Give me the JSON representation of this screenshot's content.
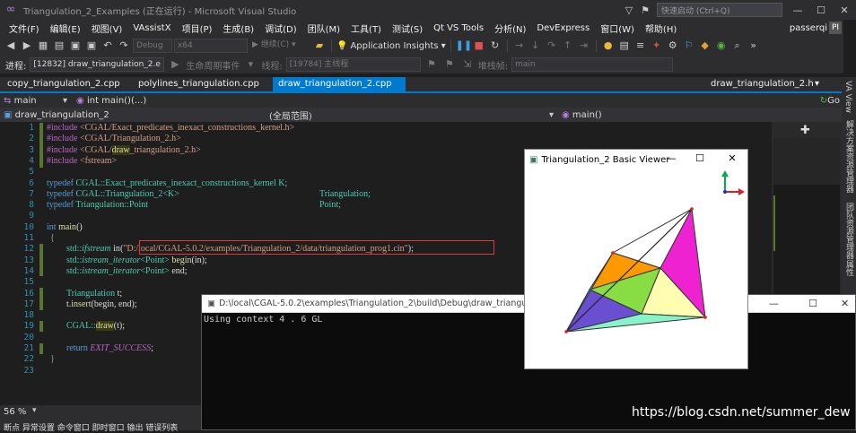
{
  "window": {
    "title": "Triangulation_2_Examples (正在运行) - Microsoft Visual Studio",
    "quick_launch_placeholder": "快速启动 (Ctrl+Q)"
  },
  "menu": [
    "文件(F)",
    "编辑(E)",
    "视图(V)",
    "VAssistX",
    "项目(P)",
    "生成(B)",
    "调试(D)",
    "团队(M)",
    "工具(T)",
    "测试(S)",
    "Qt VS Tools",
    "分析(N)",
    "DevExpress",
    "窗口(W)",
    "帮助(H)"
  ],
  "user": {
    "name": "passerqi",
    "avatar": "PI"
  },
  "toolbar": {
    "config": "Debug",
    "platform": "x64",
    "continue": "▶ 继续(C) ▾",
    "app_insights": "Application Insights"
  },
  "process_bar": {
    "process_label": "进程:",
    "process_value": "[12832] draw_triangulation_2.e",
    "lifecycle_label": "生命周期事件",
    "thread_label": "线程:",
    "thread_value": "[19784] 主线程",
    "stack_label": "堆栈帧:",
    "stack_value": "main"
  },
  "tabs": [
    "copy_triangulation_2.cpp",
    "polylines_triangulation.cpp",
    "draw_triangulation_2.cpp",
    "draw_triangulation_2.h"
  ],
  "nav": {
    "scope": "main",
    "func": "int main()(...)",
    "go": "Go"
  },
  "scope": {
    "project": "draw_triangulation_2",
    "range": "(全局范围)",
    "member": "main()"
  },
  "code_lines": [
    "1",
    "2",
    "3",
    "4",
    "5",
    "6",
    "7",
    "8",
    "9",
    "10",
    "11",
    "12",
    "13",
    "14",
    "15",
    "16",
    "17",
    "18",
    "19",
    "20",
    "21",
    "22",
    "23"
  ],
  "code": {
    "inc1a": "#include ",
    "inc1b": "<CGAL/Exact_predicates_inexact_constructions_kernel.h>",
    "inc2a": "#include ",
    "inc2b": "<CGAL/Triangulation_2.h>",
    "inc3a": "#include ",
    "inc3b": "<CGAL/",
    "inc3c": "draw",
    "inc3d": "_triangulation_2.h>",
    "inc4a": "#include ",
    "inc4b": "<fstream>",
    "td1a": "typedef ",
    "td1b": "CGAL::Exact_predicates_inexact_constructions_kernel ",
    "td1c": "K;",
    "td2a": "typedef ",
    "td2b": "CGAL::Triangulation_2<K>",
    "td2c": "Triangulation;",
    "td3a": "typedef ",
    "td3b": "Triangulation::Point",
    "td3c": "Point;",
    "main_a": "int ",
    "main_b": "main",
    "main_c": "()",
    "brace_open": "{",
    "l12a": "std::",
    "l12b": "ifstream ",
    "l12c": "in",
    "l12d": "(",
    "l12e": "\"D:/local/CGAL-5.0.2/examples/Triangulation_2/data/triangulation_prog1.cin\"",
    "l12f": ");",
    "l13a": "std::",
    "l13b": "istream_iterator",
    "l13c": "<Point> ",
    "l13d": "begin",
    "l13e": "(in);",
    "l14a": "std::",
    "l14b": "istream_iterator",
    "l14c": "<Point> ",
    "l14d": "end;",
    "l16a": "Triangulation ",
    "l16b": "t;",
    "l17a": "t.",
    "l17b": "insert",
    "l17c": "(begin, end);",
    "l19a": "CGAL::",
    "l19b": "draw",
    "l19c": "(t);",
    "l21a": "return ",
    "l21b": "EXIT_SUCCESS",
    ";": ";",
    "brace_close": "}"
  },
  "right_panel": {
    "va_view": "VA View",
    "solution": "解决方案资源管理器",
    "team": "团队资源管理器",
    "properties": "属性"
  },
  "status": {
    "zoom": "56 %",
    "bottom_tabs": "断点  异常设置  命令窗口  即时窗口  输出  错误列表"
  },
  "console": {
    "title": "D:\\local\\CGAL-5.0.2\\examples\\Triangulation_2\\build\\Debug\\draw_triangulation",
    "output": "Using context  4 . 6 GL"
  },
  "viewer": {
    "title": "Triangulation_2 Basic Viewer"
  },
  "watermark": "https://blog.csdn.net/summer_dew"
}
